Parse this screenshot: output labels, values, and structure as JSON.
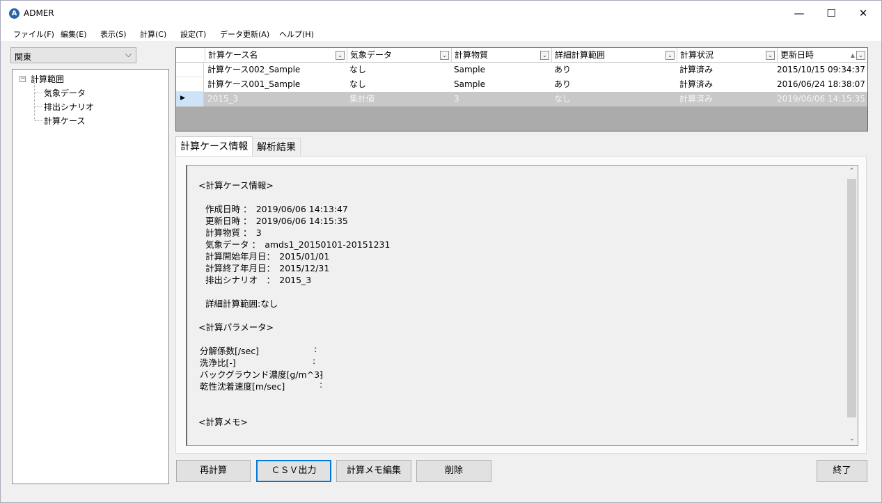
{
  "window": {
    "title": "ADMER",
    "app_icon_letter": "A",
    "controls": {
      "minimize": "—",
      "maximize": "☐",
      "close": "✕"
    }
  },
  "menu": {
    "items": [
      "ファイル(F)",
      "編集(E)",
      "表示(S)",
      "計算(C)",
      "設定(T)",
      "データ更新(A)",
      "ヘルプ(H)"
    ]
  },
  "region_select": {
    "value": "関東",
    "arrow": "⌵"
  },
  "tree": {
    "root": "計算範囲",
    "expander": "−",
    "children": [
      "気象データ",
      "排出シナリオ",
      "計算ケース"
    ]
  },
  "grid": {
    "columns": [
      "計算ケース名",
      "気象データ",
      "計算物質",
      "詳細計算範囲",
      "計算状況",
      "更新日時"
    ],
    "sort_indicator": "▲",
    "filter_icon": "⌄",
    "rows": [
      {
        "name": "計算ケース002_Sample",
        "weather": "なし",
        "substance": "Sample",
        "detail": "あり",
        "status": "計算済み",
        "updated": "2015/10/15 09:34:37",
        "selected": false
      },
      {
        "name": "計算ケース001_Sample",
        "weather": "なし",
        "substance": "Sample",
        "detail": "あり",
        "status": "計算済み",
        "updated": "2016/06/24 18:38:07",
        "selected": false
      },
      {
        "name": "2015_3",
        "weather": "集計値",
        "substance": "3",
        "detail": "なし",
        "status": "計算済み",
        "updated": "2019/06/06 14:15:35",
        "selected": true
      }
    ],
    "row_pointer": "▶"
  },
  "tabs": [
    "計算ケース情報",
    "解析結果"
  ],
  "info": {
    "header_case": "<計算ケース情報>",
    "created": "作成日時 ：　2019/06/06 14:13:47",
    "updated": "更新日時 ：　2019/06/06 14:15:35",
    "substance": "計算物質 ：　3",
    "weather": "気象データ ：　amds1_20150101-20151231",
    "start": "計算開始年月日：　2015/01/01",
    "end": "計算終了年月日：　2015/12/31",
    "scenario": "排出シナリオ　：　2015_3",
    "detail_range": "詳細計算範囲:なし",
    "header_params": "<計算パラメータ>",
    "param1_label": "分解係数[/sec]",
    "param2_label": "洗浄比[-]",
    "param3_label": "バックグラウンド濃度[g/m^3]",
    "param4_label": "乾性沈着速度[m/sec]",
    "colon": ":",
    "header_memo": "<計算メモ>"
  },
  "scroll": {
    "up": "⌃",
    "down": "⌄"
  },
  "buttons": {
    "recalc": "再計算",
    "csv": "ＣＳＶ出力",
    "memo": "計算メモ編集",
    "delete": "削除",
    "exit": "終了"
  }
}
